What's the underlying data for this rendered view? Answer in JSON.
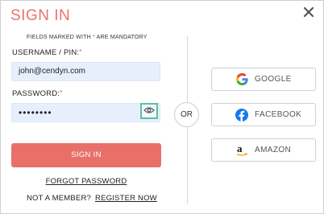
{
  "header": {
    "title": "SIGN IN",
    "close_glyph": "close-icon"
  },
  "form": {
    "mandatory_prefix": "FIELDS MARKED WITH ",
    "mandatory_star": "*",
    "mandatory_suffix": " ARE MANDATORY",
    "username_label": "USERNAME / PIN:",
    "username_value": "john@cendyn.com",
    "password_label": "PASSWORD:",
    "password_value": "••••••••",
    "required_marker": "*",
    "submit_label": "SIGN IN",
    "forgot_label": "FORGOT PASSWORD",
    "member_prompt": "NOT A MEMBER?",
    "register_label": "REGISTER NOW"
  },
  "divider": {
    "or_label": "OR"
  },
  "social": {
    "google_label": "GOOGLE",
    "facebook_label": "FACEBOOK",
    "amazon_label": "AMAZON"
  },
  "colors": {
    "accent": "#e87069",
    "title": "#e8736c",
    "input_bg": "#e8effc",
    "eye_highlight": "#58c2a0",
    "facebook": "#1877f2"
  }
}
